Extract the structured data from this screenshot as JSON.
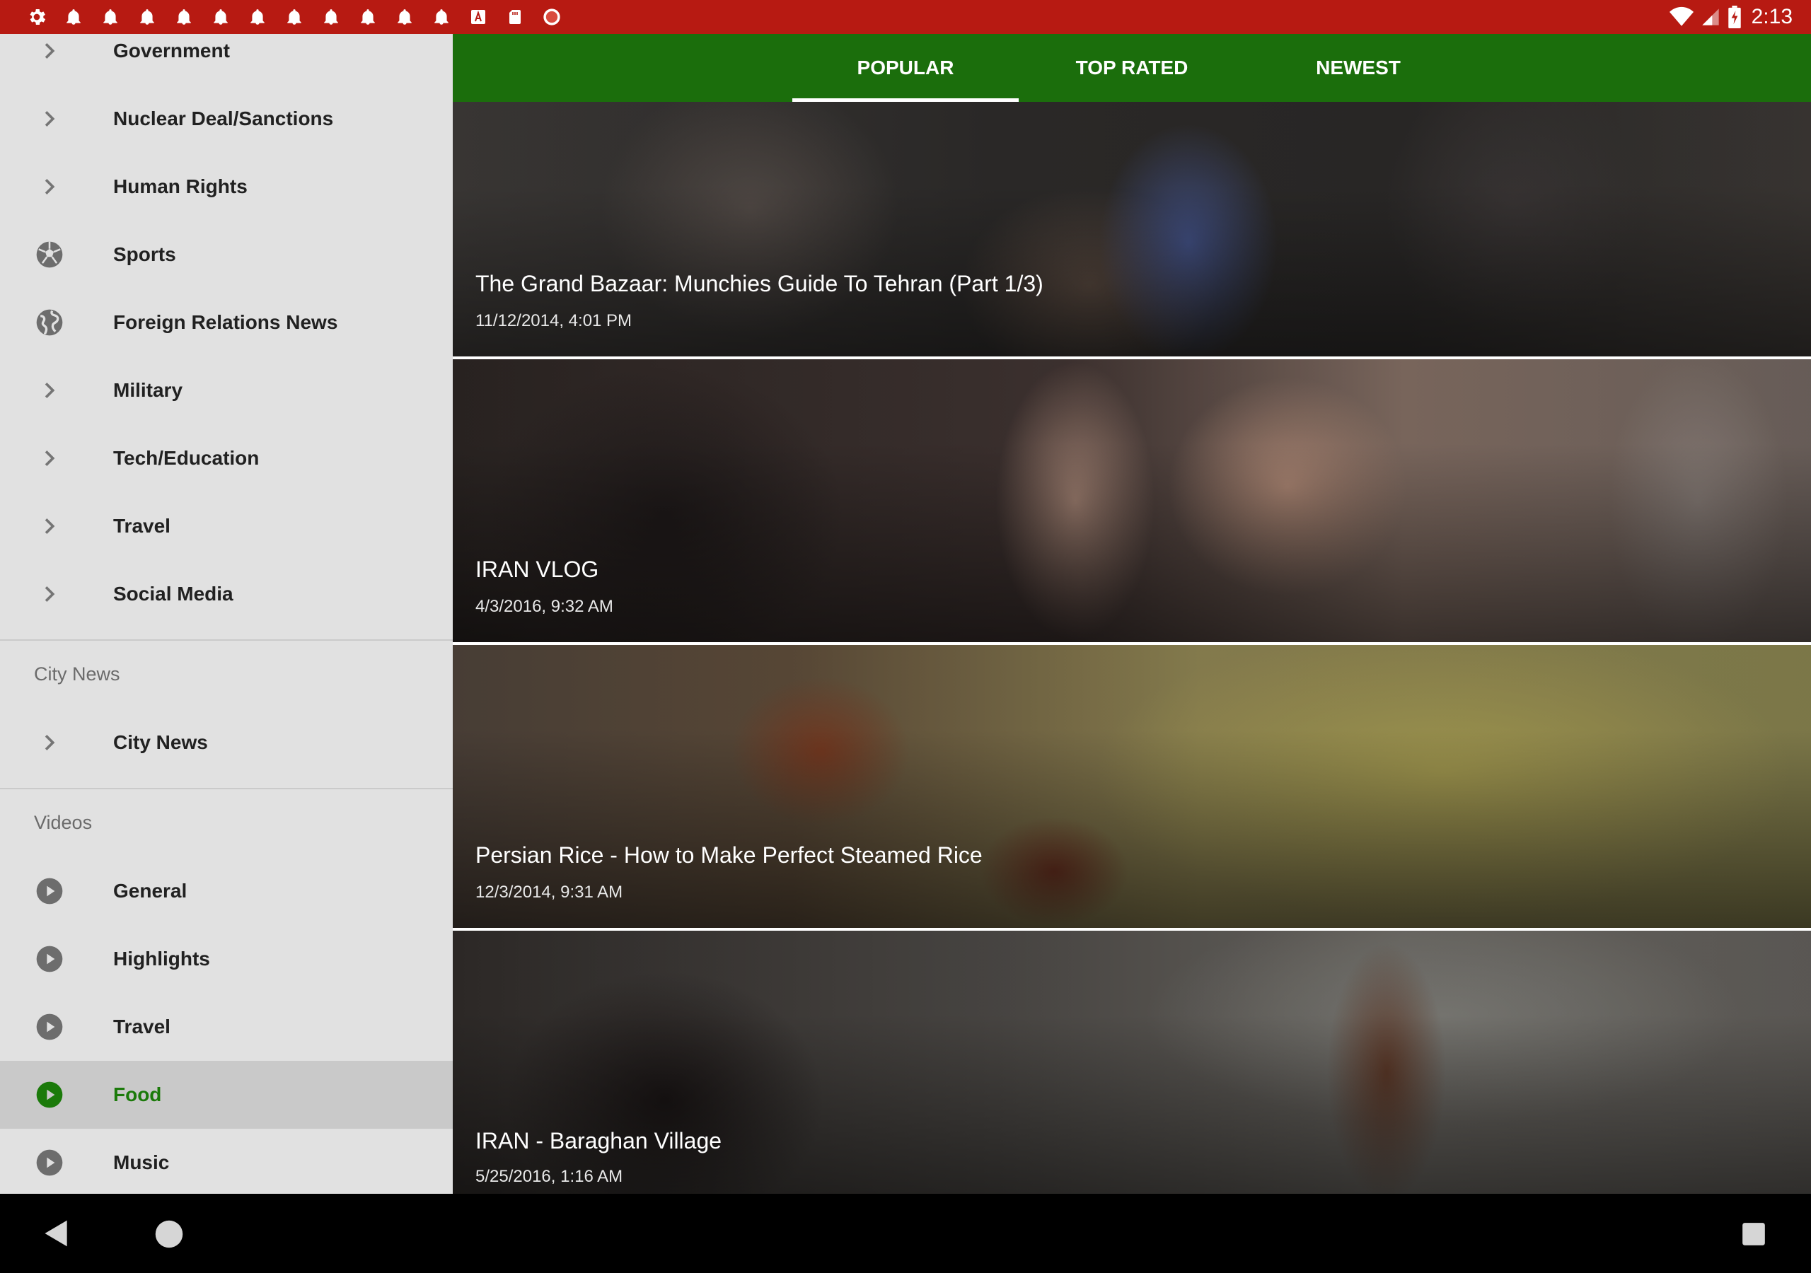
{
  "status_bar": {
    "notification_icons": [
      "gear-icon",
      "bell-icon",
      "bell-icon",
      "bell-icon",
      "bell-icon",
      "bell-icon",
      "bell-icon",
      "bell-icon",
      "bell-icon",
      "bell-icon",
      "bell-icon",
      "font-a-icon",
      "sd-card-icon",
      "record-icon"
    ],
    "time": "2:13"
  },
  "drawer": {
    "news_items": [
      {
        "label": "Government",
        "icon": "chevron-right-icon"
      },
      {
        "label": "Nuclear Deal/Sanctions",
        "icon": "chevron-right-icon"
      },
      {
        "label": "Human Rights",
        "icon": "chevron-right-icon"
      },
      {
        "label": "Sports",
        "icon": "soccer-ball-icon"
      },
      {
        "label": "Foreign Relations News",
        "icon": "globe-icon"
      },
      {
        "label": "Military",
        "icon": "chevron-right-icon"
      },
      {
        "label": "Tech/Education",
        "icon": "chevron-right-icon"
      },
      {
        "label": "Travel",
        "icon": "chevron-right-icon"
      },
      {
        "label": "Social Media",
        "icon": "chevron-right-icon"
      }
    ],
    "city_header": "City News",
    "city_items": [
      {
        "label": "City News",
        "icon": "chevron-right-icon"
      }
    ],
    "videos_header": "Videos",
    "video_items": [
      {
        "label": "General",
        "icon": "play-circle-icon"
      },
      {
        "label": "Highlights",
        "icon": "play-circle-icon"
      },
      {
        "label": "Travel",
        "icon": "play-circle-icon"
      },
      {
        "label": "Food",
        "icon": "play-circle-icon",
        "selected": true
      },
      {
        "label": "Music",
        "icon": "play-circle-icon"
      }
    ]
  },
  "tabs": [
    {
      "label": "POPULAR",
      "selected": true
    },
    {
      "label": "TOP RATED",
      "selected": false
    },
    {
      "label": "NEWEST",
      "selected": false
    }
  ],
  "videos": [
    {
      "title": "The Grand Bazaar: Munchies Guide To Tehran (Part 1/3)",
      "date": "11/12/2014, 4:01 PM"
    },
    {
      "title": "IRAN VLOG",
      "date": "4/3/2016, 9:32 AM"
    },
    {
      "title": "Persian Rice - How to Make Perfect Steamed Rice",
      "date": "12/3/2014, 9:31 AM"
    },
    {
      "title": "IRAN - Baraghan Village",
      "date": "5/25/2016, 1:16 AM"
    }
  ],
  "colors": {
    "status_bar": "#b71a12",
    "tab_bar": "#1b6e0c",
    "accent_green": "#1b7a0a",
    "drawer_bg": "#e1e1e1"
  }
}
